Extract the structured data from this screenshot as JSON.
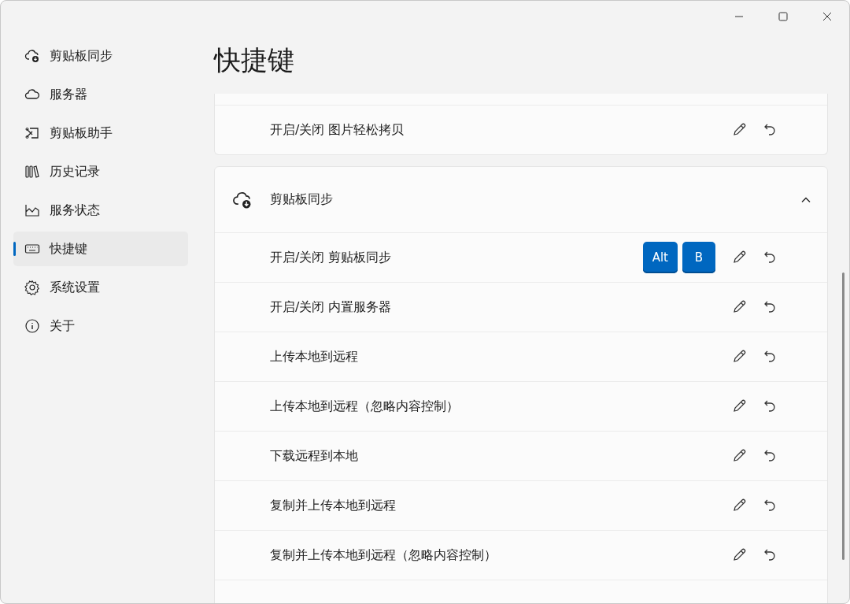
{
  "sidebar": {
    "items": [
      {
        "label": "剪贴板同步",
        "kind": "cloud-sync",
        "selected": false
      },
      {
        "label": "服务器",
        "kind": "cloud",
        "selected": false
      },
      {
        "label": "剪贴板助手",
        "kind": "scissors",
        "selected": false
      },
      {
        "label": "历史记录",
        "kind": "books",
        "selected": false
      },
      {
        "label": "服务状态",
        "kind": "chart",
        "selected": false
      },
      {
        "label": "快捷键",
        "kind": "keyboard",
        "selected": true
      },
      {
        "label": "系统设置",
        "kind": "gear",
        "selected": false
      },
      {
        "label": "关于",
        "kind": "info",
        "selected": false
      }
    ]
  },
  "page_title": "快捷键",
  "sections": [
    {
      "rows": [
        {
          "label": "开启/关闭 图片轻松拷贝",
          "keys": []
        }
      ]
    },
    {
      "title": "剪贴板同步",
      "expanded": true,
      "rows": [
        {
          "label": "开启/关闭 剪贴板同步",
          "keys": [
            "Alt",
            "B"
          ]
        },
        {
          "label": "开启/关闭 内置服务器",
          "keys": []
        },
        {
          "label": "上传本地到远程",
          "keys": []
        },
        {
          "label": "上传本地到远程（忽略内容控制）",
          "keys": []
        },
        {
          "label": "下载远程到本地",
          "keys": []
        },
        {
          "label": "复制并上传本地到远程",
          "keys": []
        },
        {
          "label": "复制并上传本地到远程（忽略内容控制）",
          "keys": []
        }
      ]
    }
  ]
}
